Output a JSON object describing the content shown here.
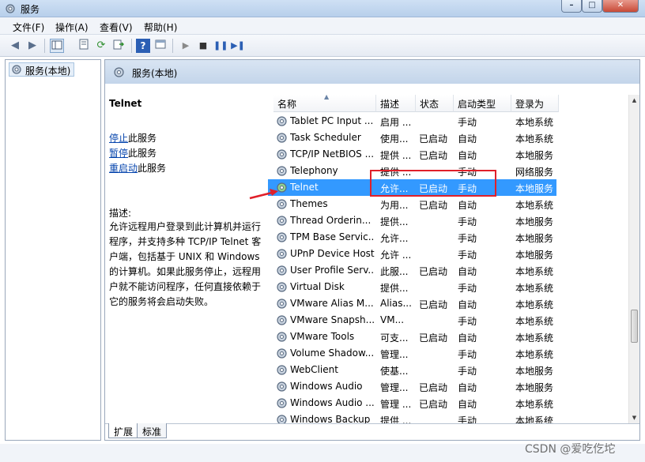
{
  "window": {
    "title": "服务",
    "path_hint": "C:\\Windows\\system32\\services.msc"
  },
  "menu": [
    "文件(F)",
    "操作(A)",
    "查看(V)",
    "帮助(H)"
  ],
  "tree": {
    "item": "服务(本地)"
  },
  "content_header": "服务(本地)",
  "desc": {
    "title": "Telnet",
    "actions": [
      {
        "link": "停止",
        "rest": "此服务"
      },
      {
        "link": "暂停",
        "rest": "此服务"
      },
      {
        "link": "重启动",
        "rest": "此服务"
      }
    ],
    "label": "描述:",
    "text": "允许远程用户登录到此计算机并运行程序，并支持多种 TCP/IP Telnet 客户端，包括基于 UNIX 和 Windows 的计算机。如果此服务停止，远程用户就不能访问程序，任何直接依赖于它的服务将会启动失败。"
  },
  "columns": [
    "名称",
    "描述",
    "状态",
    "启动类型",
    "登录为"
  ],
  "rows": [
    {
      "name": "Tablet PC Input ...",
      "desc": "启用 ...",
      "status": "",
      "start": "手动",
      "logon": "本地系统"
    },
    {
      "name": "Task Scheduler",
      "desc": "使用...",
      "status": "已启动",
      "start": "自动",
      "logon": "本地系统"
    },
    {
      "name": "TCP/IP NetBIOS ...",
      "desc": "提供 ...",
      "status": "已启动",
      "start": "自动",
      "logon": "本地服务"
    },
    {
      "name": "Telephony",
      "desc": "提供 ...",
      "status": "",
      "start": "手动",
      "logon": "网络服务"
    },
    {
      "name": "Telnet",
      "desc": "允许...",
      "status": "已启动",
      "start": "手动",
      "logon": "本地服务"
    },
    {
      "name": "Themes",
      "desc": "为用...",
      "status": "已启动",
      "start": "自动",
      "logon": "本地系统"
    },
    {
      "name": "Thread Orderin...",
      "desc": "提供...",
      "status": "",
      "start": "手动",
      "logon": "本地服务"
    },
    {
      "name": "TPM Base Servic...",
      "desc": "允许...",
      "status": "",
      "start": "手动",
      "logon": "本地服务"
    },
    {
      "name": "UPnP Device Host",
      "desc": "允许 ...",
      "status": "",
      "start": "手动",
      "logon": "本地服务"
    },
    {
      "name": "User Profile Serv...",
      "desc": "此服...",
      "status": "已启动",
      "start": "自动",
      "logon": "本地系统"
    },
    {
      "name": "Virtual Disk",
      "desc": "提供...",
      "status": "",
      "start": "手动",
      "logon": "本地系统"
    },
    {
      "name": "VMware Alias M...",
      "desc": "Alias...",
      "status": "已启动",
      "start": "自动",
      "logon": "本地系统"
    },
    {
      "name": "VMware Snapsh...",
      "desc": "VM...",
      "status": "",
      "start": "手动",
      "logon": "本地系统"
    },
    {
      "name": "VMware Tools",
      "desc": "可支...",
      "status": "已启动",
      "start": "自动",
      "logon": "本地系统"
    },
    {
      "name": "Volume Shadow...",
      "desc": "管理...",
      "status": "",
      "start": "手动",
      "logon": "本地系统"
    },
    {
      "name": "WebClient",
      "desc": "使基...",
      "status": "",
      "start": "手动",
      "logon": "本地服务"
    },
    {
      "name": "Windows Audio",
      "desc": "管理...",
      "status": "已启动",
      "start": "自动",
      "logon": "本地服务"
    },
    {
      "name": "Windows Audio ...",
      "desc": "管理 ...",
      "status": "已启动",
      "start": "自动",
      "logon": "本地系统"
    },
    {
      "name": "Windows Backup",
      "desc": "提供 ...",
      "status": "",
      "start": "手动",
      "logon": "本地系统"
    }
  ],
  "selected_row": 4,
  "tabs": [
    "扩展",
    "标准"
  ],
  "watermark": "CSDN @爱吃仡坨",
  "colors": {
    "selection": "#3399ff",
    "annotation": "#e0202a",
    "link": "#0645ad"
  }
}
